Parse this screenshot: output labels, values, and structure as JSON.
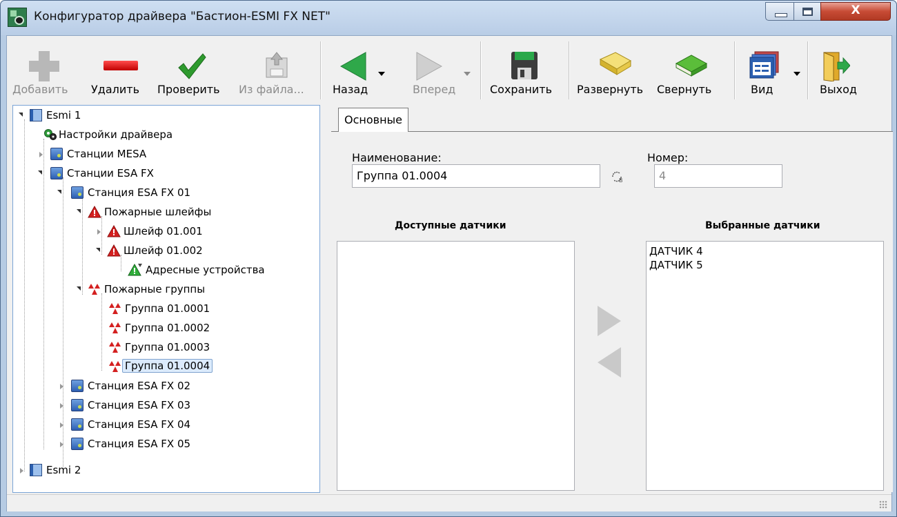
{
  "window": {
    "title": "Конфигуратор драйвера \"Бастион-ESMI FX NET\"",
    "close_glyph": "X"
  },
  "toolbar": {
    "add": "Добавить",
    "delete": "Удалить",
    "check": "Проверить",
    "from_file": "Из файла...",
    "back": "Назад",
    "forward": "Вперед",
    "save": "Сохранить",
    "expand": "Развернуть",
    "collapse": "Свернуть",
    "view": "Вид",
    "exit": "Выход"
  },
  "tree": {
    "nodes": [
      "Esmi 1",
      "Настройки драйвера",
      "Станции MESA",
      "Станции ESA FX",
      "Станция ESA FX 01",
      "Пожарные шлейфы",
      "Шлейф 01.001",
      "Шлейф 01.002",
      "Адресные устройства",
      "Пожарные группы",
      "Группа 01.0001",
      "Группа 01.0002",
      "Группа 01.0003",
      "Группа 01.0004",
      "Станция ESA FX 02",
      "Станция ESA FX 03",
      "Станция ESA FX 04",
      "Станция ESA FX 05",
      "Esmi 2"
    ]
  },
  "panel": {
    "tab": "Основные",
    "name_label": "Наименование:",
    "name_value": "Группа 01.0004",
    "number_label": "Номер:",
    "number_value": "4",
    "available_header": "Доступные датчики",
    "selected_header": "Выбранные датчики",
    "available_items": [],
    "selected_items": [
      "ДАТЧИК 4",
      "ДАТЧИК 5"
    ]
  },
  "colors": {
    "accent": "#7aa4d6",
    "selection": "#dcebfc",
    "delete_red": "#d40000",
    "check_green": "#2e9a2e"
  }
}
